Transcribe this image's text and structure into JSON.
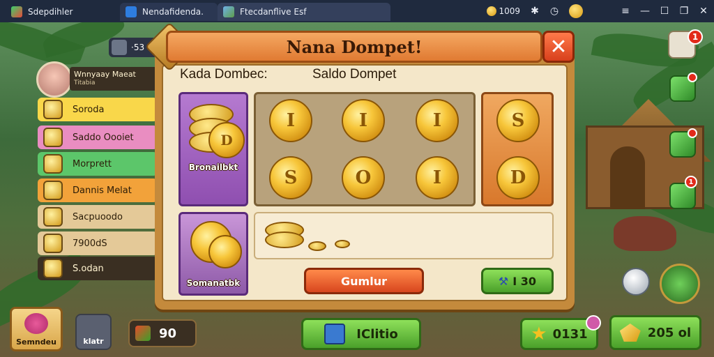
{
  "chrome": {
    "tabs": [
      {
        "label": "Sdepdihler"
      },
      {
        "label": "Nendafidenda."
      },
      {
        "label": "Ftecdanflive Esf"
      }
    ],
    "coins": "1009"
  },
  "sidebar": {
    "chat_count": "·53",
    "player_name": "Wnnyaay Maeat",
    "player_subtitle": "Titabia",
    "items": [
      {
        "label": "Soroda",
        "color": "#f9d74a",
        "icon": "coin-icon"
      },
      {
        "label": "Saddo Oooiet",
        "color": "#e98dc1",
        "icon": "wallet-icon"
      },
      {
        "label": "Morprett",
        "color": "#5cc66a",
        "icon": "gem-icon"
      },
      {
        "label": "Dannis Melat",
        "color": "#f2a23a",
        "icon": "bag-icon"
      },
      {
        "label": "Sacpuoodo",
        "color": "#e4c998",
        "icon": "scroll-icon"
      },
      {
        "label": "7900dS",
        "color": "#e4c998",
        "icon": "coin-icon"
      },
      {
        "label": "S.odan",
        "color": "#3a2f22",
        "icon": "pig-icon"
      }
    ]
  },
  "dialog": {
    "title": "Nana Dompet!",
    "left_label": "Kada Dombec:",
    "right_label": "Saldo Dompet",
    "panel1_label": "Bronailbkt",
    "panel2_label": "Somanatbk",
    "coins_row1": [
      "I",
      "I",
      "I"
    ],
    "coins_row2": [
      "S",
      "O",
      "I"
    ],
    "side_coins": [
      "S",
      "D"
    ],
    "button_orange": "Gumlur",
    "button_green_value": "I 30"
  },
  "footer": {
    "left_button": "Semndeu",
    "second_button": "klatr",
    "gold_value": "90",
    "center_button": "IClitio",
    "star_value": "0131",
    "gem_value": "205 ol"
  },
  "right_badges": [
    "1",
    "",
    "",
    "1"
  ]
}
